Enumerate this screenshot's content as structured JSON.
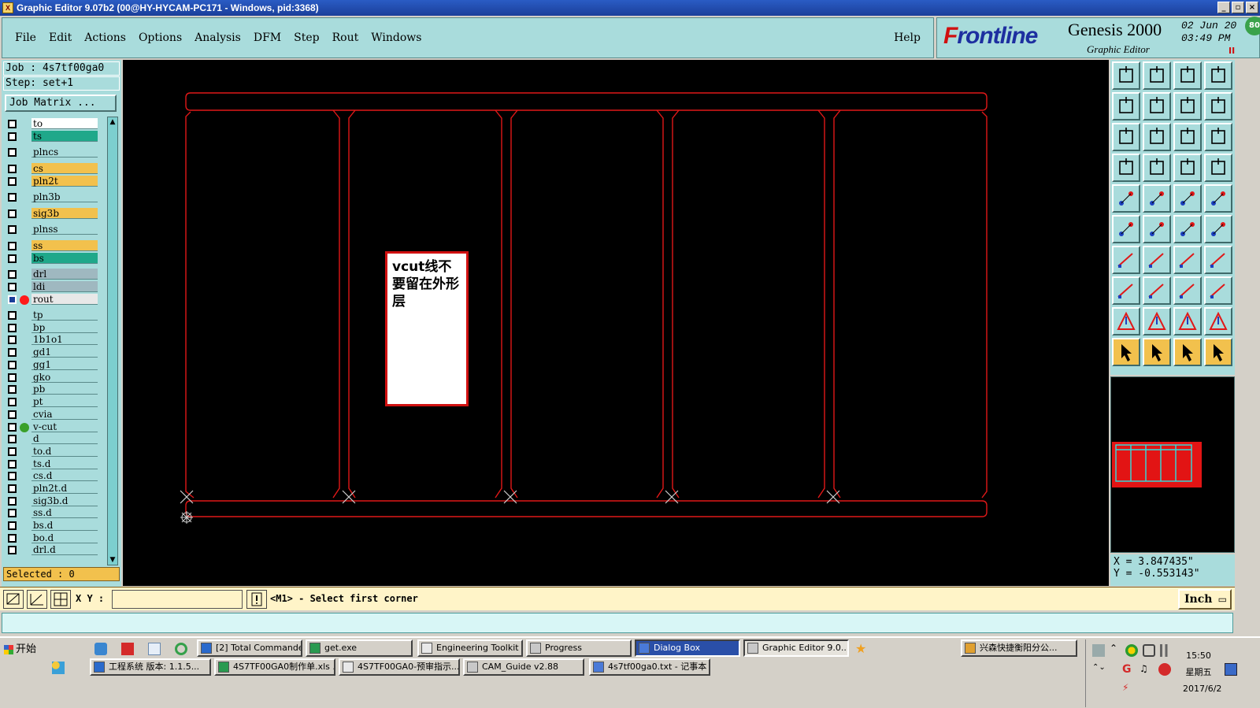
{
  "window": {
    "title": "Graphic Editor 9.07b2 (00@HY-HYCAM-PC171 - Windows, pid:3368)",
    "buttons": [
      "_",
      "▫",
      "×"
    ]
  },
  "menu": {
    "items": [
      "File",
      "Edit",
      "Actions",
      "Options",
      "Analysis",
      "DFM",
      "Step",
      "Rout",
      "Windows"
    ],
    "help": "Help"
  },
  "logo": {
    "brand_a": "F",
    "brand_b": "rontline",
    "product": "Genesis 2000",
    "subtitle": "Graphic Editor",
    "date": "02 Jun 20",
    "time": "03:49 PM",
    "pause_glyph": "II",
    "badge": "80"
  },
  "job": {
    "job_label": "Job : 4s7tf00ga0",
    "step_label": "Step: set+1",
    "job_matrix_button": "Job Matrix ...",
    "selected_label": "Selected : 0"
  },
  "layers": [
    {
      "name": "to",
      "color": "#ffffff"
    },
    {
      "name": "ts",
      "color": "#1fa88a"
    },
    {
      "name": "plncs",
      "color": "#a9dcdc"
    },
    {
      "name": "cs",
      "color": "#f2c14d"
    },
    {
      "name": "pln2t",
      "color": "#f2c14d"
    },
    {
      "name": "pln3b",
      "color": "#a9dcdc"
    },
    {
      "name": "sig3b",
      "color": "#f2c14d"
    },
    {
      "name": "plnss",
      "color": "#a9dcdc"
    },
    {
      "name": "ss",
      "color": "#f2c14d"
    },
    {
      "name": "bs",
      "color": "#1fa88a"
    },
    {
      "name": "drl",
      "color": "#9fb8c0"
    },
    {
      "name": "ldi",
      "color": "#9fb8c0"
    },
    {
      "name": "rout",
      "color": "#e8e8e8",
      "marker": "#ff1a1a",
      "active": true
    },
    {
      "name": "tp",
      "color": "#a9dcdc"
    },
    {
      "name": "bp",
      "color": "#a9dcdc"
    },
    {
      "name": "1b1o1",
      "color": "#a9dcdc"
    },
    {
      "name": "gd1",
      "color": "#a9dcdc"
    },
    {
      "name": "gg1",
      "color": "#a9dcdc"
    },
    {
      "name": "gko",
      "color": "#a9dcdc"
    },
    {
      "name": "pb",
      "color": "#a9dcdc"
    },
    {
      "name": "pt",
      "color": "#a9dcdc"
    },
    {
      "name": "cvia",
      "color": "#a9dcdc"
    },
    {
      "name": "v-cut",
      "color": "#a9dcdc",
      "marker": "#3aa02a"
    },
    {
      "name": "d",
      "color": "#a9dcdc"
    },
    {
      "name": "to.d",
      "color": "#a9dcdc"
    },
    {
      "name": "ts.d",
      "color": "#a9dcdc"
    },
    {
      "name": "cs.d",
      "color": "#a9dcdc"
    },
    {
      "name": "pln2t.d",
      "color": "#a9dcdc"
    },
    {
      "name": "sig3b.d",
      "color": "#a9dcdc"
    },
    {
      "name": "ss.d",
      "color": "#a9dcdc"
    },
    {
      "name": "bs.d",
      "color": "#a9dcdc"
    },
    {
      "name": "bo.d",
      "color": "#a9dcdc"
    },
    {
      "name": "drl.d",
      "color": "#a9dcdc"
    }
  ],
  "canvas": {
    "note_text": "vcut线不要留在外形层",
    "outline_color": "#e01818"
  },
  "coords": {
    "x": "X  = 3.847435\"",
    "y": "Y  = -0.553143\""
  },
  "command": {
    "xy_label": "X Y :",
    "xy_value": "",
    "prompt": "<M1> - Select first corner",
    "unit": "Inch"
  },
  "taskbar": {
    "start": "开始",
    "row1": [
      "[2] Total Commander...",
      "get.exe",
      "Engineering Toolkit 9...",
      "Progress",
      "Dialog Box",
      "Graphic Editor 9.0...",
      "兴森快捷衡阳分公..."
    ],
    "row2": [
      "工程系统  版本: 1.1.5...",
      "4S7TF00GA0制作单.xls ...",
      "4S7TF00GA0-预审指示...",
      "CAM_Guide v2.88",
      "4s7tf00ga0.txt - 记事本"
    ],
    "clock_time": "15:50",
    "clock_day": "星期五",
    "clock_date": "2017/6/2"
  }
}
